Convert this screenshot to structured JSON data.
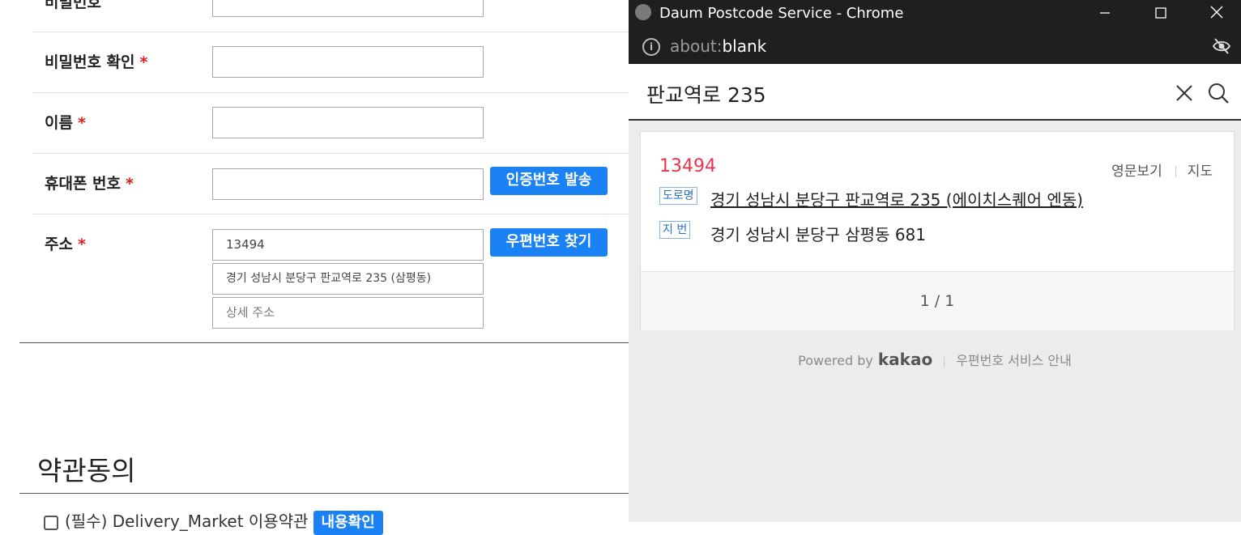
{
  "form": {
    "partial_label": "비밀번호",
    "rows": [
      {
        "label": "비밀번호 확인",
        "required": "*"
      },
      {
        "label": "이름",
        "required": "*"
      },
      {
        "label": "휴대폰 번호",
        "required": "*",
        "button": "인증번호 발송"
      },
      {
        "label": "주소",
        "required": "*",
        "button": "우편번호 찾기"
      }
    ],
    "address": {
      "zip_value": "13494",
      "road_value": "경기 성남시 분당구 판교역로 235 (삼평동)",
      "detail_placeholder": "상세 주소"
    },
    "terms_title": "약관동의",
    "agree_label": "(필수) Delivery_Market 이용약관",
    "agree_button": "내용확인"
  },
  "popup": {
    "window_title": "Daum Postcode Service - Chrome",
    "url_scheme": "about:",
    "url_host": "blank",
    "search_query": "판교역로 235",
    "result": {
      "zip": "13494",
      "english_link": "영문보기",
      "map_link": "지도",
      "road_tag": "도로명",
      "road_address": "경기 성남시 분당구 판교역로 235 (에이치스퀘어 엔동)",
      "jibun_tag": "지 번",
      "jibun_address": "경기 성남시 분당구 삼평동 681"
    },
    "pagination": "1 / 1",
    "footer": {
      "powered_by": "Powered by",
      "brand": "kakao",
      "service_info": "우편번호 서비스 안내"
    }
  }
}
